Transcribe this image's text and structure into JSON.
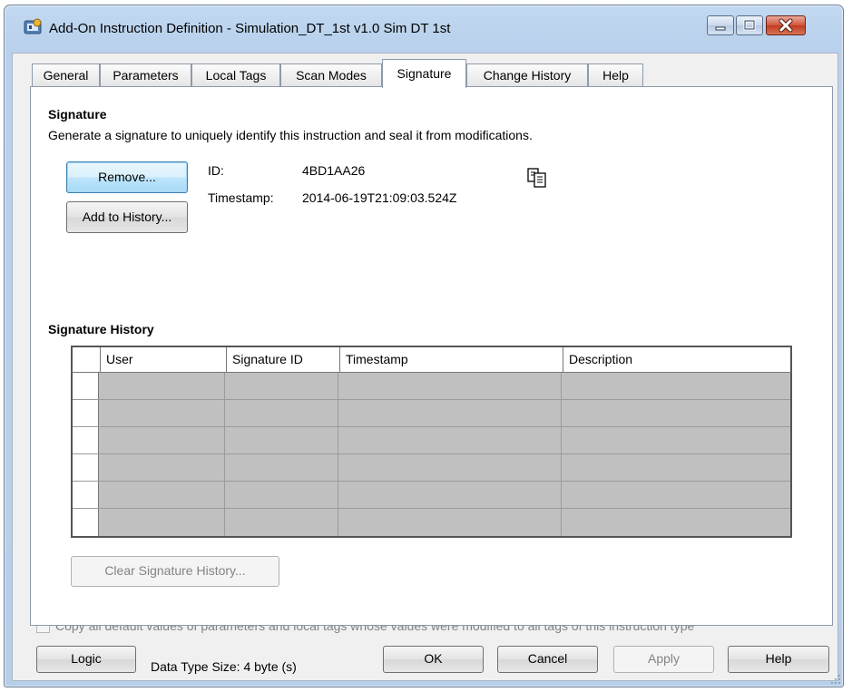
{
  "window": {
    "title": "Add-On Instruction Definition - Simulation_DT_1st v1.0 Sim DT 1st"
  },
  "tabs": [
    {
      "label": "General"
    },
    {
      "label": "Parameters"
    },
    {
      "label": "Local Tags"
    },
    {
      "label": "Scan Modes"
    },
    {
      "label": "Signature",
      "active": true
    },
    {
      "label": "Change History"
    },
    {
      "label": "Help"
    }
  ],
  "signature": {
    "heading": "Signature",
    "description": "Generate a signature to uniquely identify this instruction and seal it from modifications.",
    "remove_label": "Remove...",
    "add_history_label": "Add to History...",
    "id_label": "ID:",
    "id_value": "4BD1AA26",
    "timestamp_label": "Timestamp:",
    "timestamp_value": "2014-06-19T21:09:03.524Z",
    "copy_icon": "copy-icon"
  },
  "history": {
    "heading": "Signature History",
    "columns": [
      "User",
      "Signature ID",
      "Timestamp",
      "Description"
    ],
    "rows": [
      [
        "",
        "",
        "",
        ""
      ],
      [
        "",
        "",
        "",
        ""
      ],
      [
        "",
        "",
        "",
        ""
      ],
      [
        "",
        "",
        "",
        ""
      ],
      [
        "",
        "",
        "",
        ""
      ],
      [
        "",
        "",
        "",
        ""
      ]
    ],
    "clear_label": "Clear Signature History..."
  },
  "footer": {
    "copy_defaults_label": "Copy all default values of parameters and local tags whose values were modified to all tags of this instruction type",
    "copy_defaults_checked": false,
    "logic_label": "Logic",
    "data_type_size": "Data Type Size: 4 byte (s)",
    "ok_label": "OK",
    "cancel_label": "Cancel",
    "apply_label": "Apply",
    "help_label": "Help"
  }
}
